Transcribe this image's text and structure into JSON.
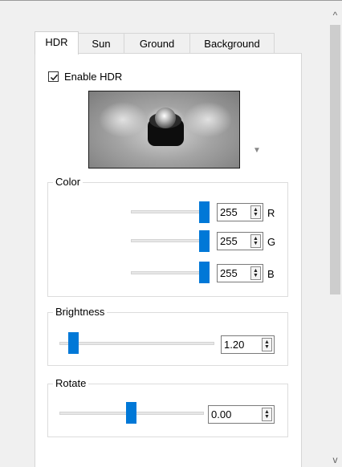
{
  "tabs": [
    {
      "label": "HDR",
      "active": true
    },
    {
      "label": "Sun",
      "active": false
    },
    {
      "label": "Ground",
      "active": false
    },
    {
      "label": "Background",
      "active": false
    }
  ],
  "enable_hdr": {
    "label": "Enable HDR",
    "checked": true
  },
  "color": {
    "title": "Color",
    "channels": [
      {
        "label": "R",
        "value": "255"
      },
      {
        "label": "G",
        "value": "255"
      },
      {
        "label": "B",
        "value": "255"
      }
    ]
  },
  "brightness": {
    "title": "Brightness",
    "value": "1.20"
  },
  "rotate": {
    "title": "Rotate",
    "value": "0.00"
  },
  "icons": {
    "spin_up": "▲",
    "spin_down": "▼",
    "scroll_up": "^",
    "scroll_down": "v",
    "dropdown": "▼"
  },
  "colors": {
    "accent": "#0078d7"
  }
}
